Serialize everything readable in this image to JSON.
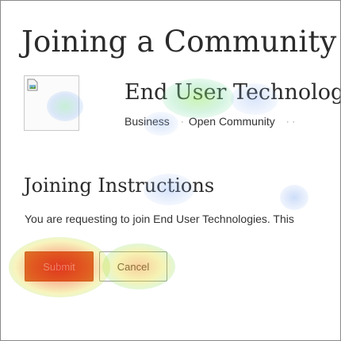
{
  "page": {
    "title": "Joining a Community"
  },
  "community": {
    "name": "End User Technologies",
    "category": "Business",
    "separator": "·",
    "type": "Open Community",
    "more_separator": "· ·"
  },
  "joining": {
    "section_title": "Joining Instructions",
    "instructions": "You are requesting to join End User Technologies. This"
  },
  "actions": {
    "submit_label": "Submit",
    "cancel_label": "Cancel"
  },
  "icons": {
    "logo_placeholder": "broken-image-icon"
  },
  "colors": {
    "submit_bg": "#d74a2a",
    "text": "#2b2b2b"
  }
}
